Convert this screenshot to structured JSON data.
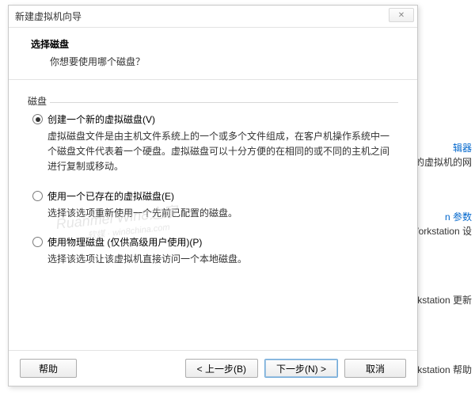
{
  "dialog": {
    "title": "新建虚拟机向导",
    "close": "✕",
    "heading": "选择磁盘",
    "subheading": "你想要使用哪个磁盘？"
  },
  "group": {
    "label": "磁盘"
  },
  "options": [
    {
      "label": "创建一个新的虚拟磁盘(V)",
      "desc": "虚拟磁盘文件是由主机文件系统上的一个或多个文件组成，在客户机操作系统中一个磁盘文件代表着一个硬盘。虚拟磁盘可以十分方便的在相同的或不同的主机之间进行复制或移动。",
      "checked": true
    },
    {
      "label": "使用一个已存在的虚拟磁盘(E)",
      "desc": "选择该选项重新使用一个先前已配置的磁盘。",
      "checked": false
    },
    {
      "label": "使用物理磁盘 (仅供高级用户使用)(P)",
      "desc": "选择该选项让该虚拟机直接访问一个本地磁盘。",
      "checked": false
    }
  ],
  "buttons": {
    "help": "帮助",
    "back": "< 上一步(B)",
    "next": "下一步(N) >",
    "cancel": "取消"
  },
  "watermark": {
    "main": "Ruanmei Win8之家",
    "sub": "软媒 · win8china.com"
  },
  "background": {
    "item1a": "辑器",
    "item1b": "刂机上的虚拟机的网",
    "item2a": "n 参数",
    "item2b": "are Workstation 设",
    "item3": "Workstation 更新",
    "item4": "Workstation 帮助"
  }
}
